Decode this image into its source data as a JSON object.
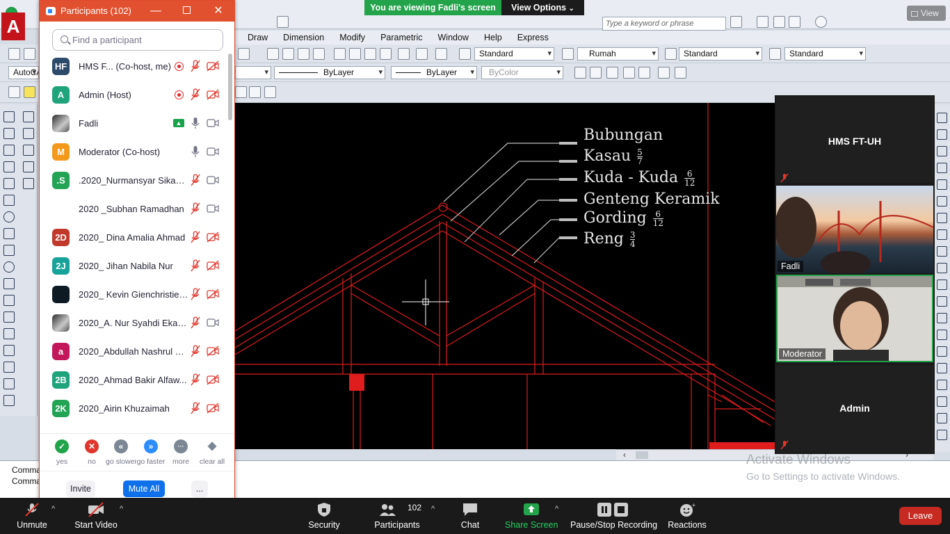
{
  "banner": {
    "viewing": "You are viewing Fadli's screen",
    "view_options": "View Options",
    "view_corner": "View"
  },
  "autocad": {
    "logo": "A",
    "search_placeholder": "Type a keyword or phrase",
    "menu": [
      "Draw",
      "Dimension",
      "Modify",
      "Parametric",
      "Window",
      "Help",
      "Express"
    ],
    "workspace_label": "AutoCA",
    "styles": {
      "text_style": "Standard",
      "dim_style": "Rumah",
      "table_style": "Standard",
      "multileader_style": "Standard"
    },
    "properties": {
      "layer_combo": "",
      "linetype": "ByLayer",
      "lineweight": "ByLayer",
      "plot_style": "ByColor"
    },
    "drawing_labels": [
      {
        "text": "Bubungan",
        "frac_num": "",
        "frac_den": ""
      },
      {
        "text": "Kasau",
        "frac_num": "5",
        "frac_den": "7"
      },
      {
        "text": "Kuda - Kuda",
        "frac_num": "6",
        "frac_den": "12"
      },
      {
        "text": "Genteng Keramik",
        "frac_num": "",
        "frac_den": ""
      },
      {
        "text": "Gording",
        "frac_num": "6",
        "frac_den": "12"
      },
      {
        "text": "Reng",
        "frac_num": "3",
        "frac_den": "4"
      }
    ],
    "command_lines": [
      "Comma",
      "Comma"
    ],
    "activate_title": "Activate Windows",
    "activate_sub": "Go to Settings to activate Windows."
  },
  "participants": {
    "title": "Participants (102)",
    "search_placeholder": "Find a participant",
    "list": [
      {
        "initials": "HF",
        "color": "#2d4a6b",
        "name": "HMS F...  (Co-host, me)",
        "rec": true,
        "share": false,
        "mic": "muted",
        "cam": "off"
      },
      {
        "initials": "A",
        "color": "#1fa37a",
        "name": "Admin (Host)",
        "rec": true,
        "share": false,
        "mic": "muted",
        "cam": "off"
      },
      {
        "initials": "",
        "color": "",
        "name": "Fadli",
        "rec": false,
        "share": true,
        "mic": "on",
        "cam": "on",
        "photo": true
      },
      {
        "initials": "M",
        "color": "#f39a1c",
        "name": "Moderator (Co-host)",
        "rec": false,
        "share": false,
        "mic": "on",
        "cam": "on"
      },
      {
        "initials": ".S",
        "color": "#23a455",
        "name": ".2020_Nurmansyar Sikande",
        "rec": false,
        "share": false,
        "mic": "muted",
        "cam": "on"
      },
      {
        "initials": "",
        "color": "#ffffff",
        "name": "2020 _Subhan Ramadhan",
        "rec": false,
        "share": false,
        "mic": "muted",
        "cam": "on"
      },
      {
        "initials": "2D",
        "color": "#c0392b",
        "name": "2020_ Dina Amalia Ahmad",
        "rec": false,
        "share": false,
        "mic": "muted",
        "cam": "off"
      },
      {
        "initials": "2J",
        "color": "#18a39a",
        "name": "2020_ Jihan Nabila Nur",
        "rec": false,
        "share": false,
        "mic": "muted",
        "cam": "off"
      },
      {
        "initials": "",
        "color": "#0d1a24",
        "name": "2020_ Kevin Gienchristie ...",
        "rec": false,
        "share": false,
        "mic": "muted",
        "cam": "off"
      },
      {
        "initials": "",
        "color": "",
        "name": "2020_A. Nur Syahdi Eka S...",
        "rec": false,
        "share": false,
        "mic": "muted",
        "cam": "on",
        "photo": true
      },
      {
        "initials": "a",
        "color": "#c2185b",
        "name": "2020_Abdullah Nashrul H...",
        "rec": false,
        "share": false,
        "mic": "muted",
        "cam": "off"
      },
      {
        "initials": "2B",
        "color": "#1fa37a",
        "name": "2020_Ahmad Bakir Alfaw...",
        "rec": false,
        "share": false,
        "mic": "muted",
        "cam": "off"
      },
      {
        "initials": "2K",
        "color": "#23a455",
        "name": "2020_Airin Khuzaimah",
        "rec": false,
        "share": false,
        "mic": "muted",
        "cam": "off"
      }
    ],
    "reactions": [
      {
        "label": "yes",
        "color": "#20a34a",
        "glyph": "✓"
      },
      {
        "label": "no",
        "color": "#e0362c",
        "glyph": "✕"
      },
      {
        "label": "go slower",
        "color": "#7b8794",
        "glyph": "«"
      },
      {
        "label": "go faster",
        "color": "#2d8cff",
        "glyph": "»"
      },
      {
        "label": "more",
        "color": "#7b8794",
        "glyph": "···"
      },
      {
        "label": "clear all",
        "color": "#7b8794",
        "glyph": "◆"
      }
    ],
    "invite": "Invite",
    "mute_all": "Mute All",
    "more": "..."
  },
  "videos": [
    {
      "name": "HMS FT-UH",
      "type": "name",
      "muted": true
    },
    {
      "name": "Fadli",
      "type": "video",
      "muted": false
    },
    {
      "name": "Moderator",
      "type": "video",
      "muted": false
    },
    {
      "name": "Admin",
      "type": "name",
      "muted": true
    }
  ],
  "controls": {
    "unmute": "Unmute",
    "start_video": "Start Video",
    "security": "Security",
    "participants": "Participants",
    "participant_count": "102",
    "chat": "Chat",
    "share_screen": "Share Screen",
    "recording": "Pause/Stop Recording",
    "reactions": "Reactions",
    "leave": "Leave"
  },
  "colors": {
    "zoom_orange": "#e2512f",
    "zoom_blue": "#2d8cff",
    "share_green": "#23a34a",
    "leave_red": "#c62a21",
    "cad_red": "#e01d1d"
  }
}
